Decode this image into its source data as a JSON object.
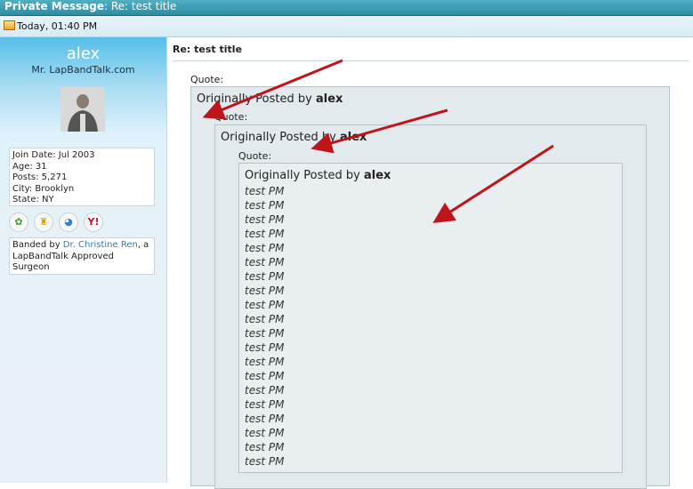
{
  "titlebar": {
    "label": "Private Message",
    "title": "Re: test title"
  },
  "datebar": {
    "text": "Today, 01:40 PM"
  },
  "user": {
    "name": "alex",
    "title": "Mr. LapBandTalk.com",
    "info": [
      "Join Date: Jul 2003",
      "Age: 31",
      "Posts: 5,271",
      "City: Brooklyn",
      "State: NY"
    ],
    "contact_icons": [
      "icq-icon",
      "aim-icon",
      "msn-icon",
      "yahoo-icon"
    ],
    "banded": {
      "prefix": "Banded by ",
      "doctor": "Dr. Christine Ren",
      "suffix": ", a LapBandTalk Approved Surgeon"
    }
  },
  "post": {
    "title": "Re: test title",
    "quote_label": "Quote:",
    "originally_posted_by": "Originally Posted by",
    "author": "alex",
    "messages": [
      "test PM",
      "test PM",
      "test PM",
      "test PM",
      "test PM",
      "test PM",
      "test PM",
      "test PM",
      "test PM",
      "test PM",
      "test PM",
      "test PM",
      "test PM",
      "test PM",
      "test PM",
      "test PM",
      "test PM",
      "test PM",
      "test PM",
      "test PM"
    ]
  },
  "colors": {
    "titlebar": "#2d8ca3",
    "link": "#2d80a8",
    "annotation_arrow": "#c0141b"
  }
}
